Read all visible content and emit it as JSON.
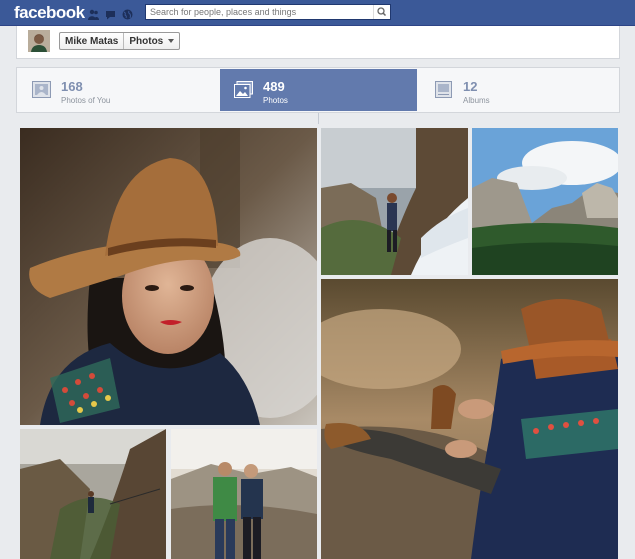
{
  "header": {
    "logo": "facebook",
    "icons": [
      "friend-requests-icon",
      "messages-icon",
      "notifications-globe-icon"
    ],
    "search_placeholder": "Search for people, places and things"
  },
  "breadcrumb": {
    "name": "Mike Matas",
    "section": "Photos"
  },
  "tabs": [
    {
      "count": "168",
      "label": "Photos of You",
      "active": false,
      "icon": "photos-of-you-icon"
    },
    {
      "count": "489",
      "label": "Photos",
      "active": true,
      "icon": "photos-icon"
    },
    {
      "count": "12",
      "label": "Albums",
      "active": false,
      "icon": "albums-icon"
    }
  ],
  "colors": {
    "brand": "#3b5998",
    "active_tab": "#627aad",
    "background": "#e9ebee"
  },
  "photos": [
    {
      "name": "woman-hat-portrait"
    },
    {
      "name": "hiker-snow-slope"
    },
    {
      "name": "valley-landscape"
    },
    {
      "name": "seated-hiker-closeup"
    },
    {
      "name": "cliff-trail-hiker"
    },
    {
      "name": "couple-mountain"
    }
  ]
}
